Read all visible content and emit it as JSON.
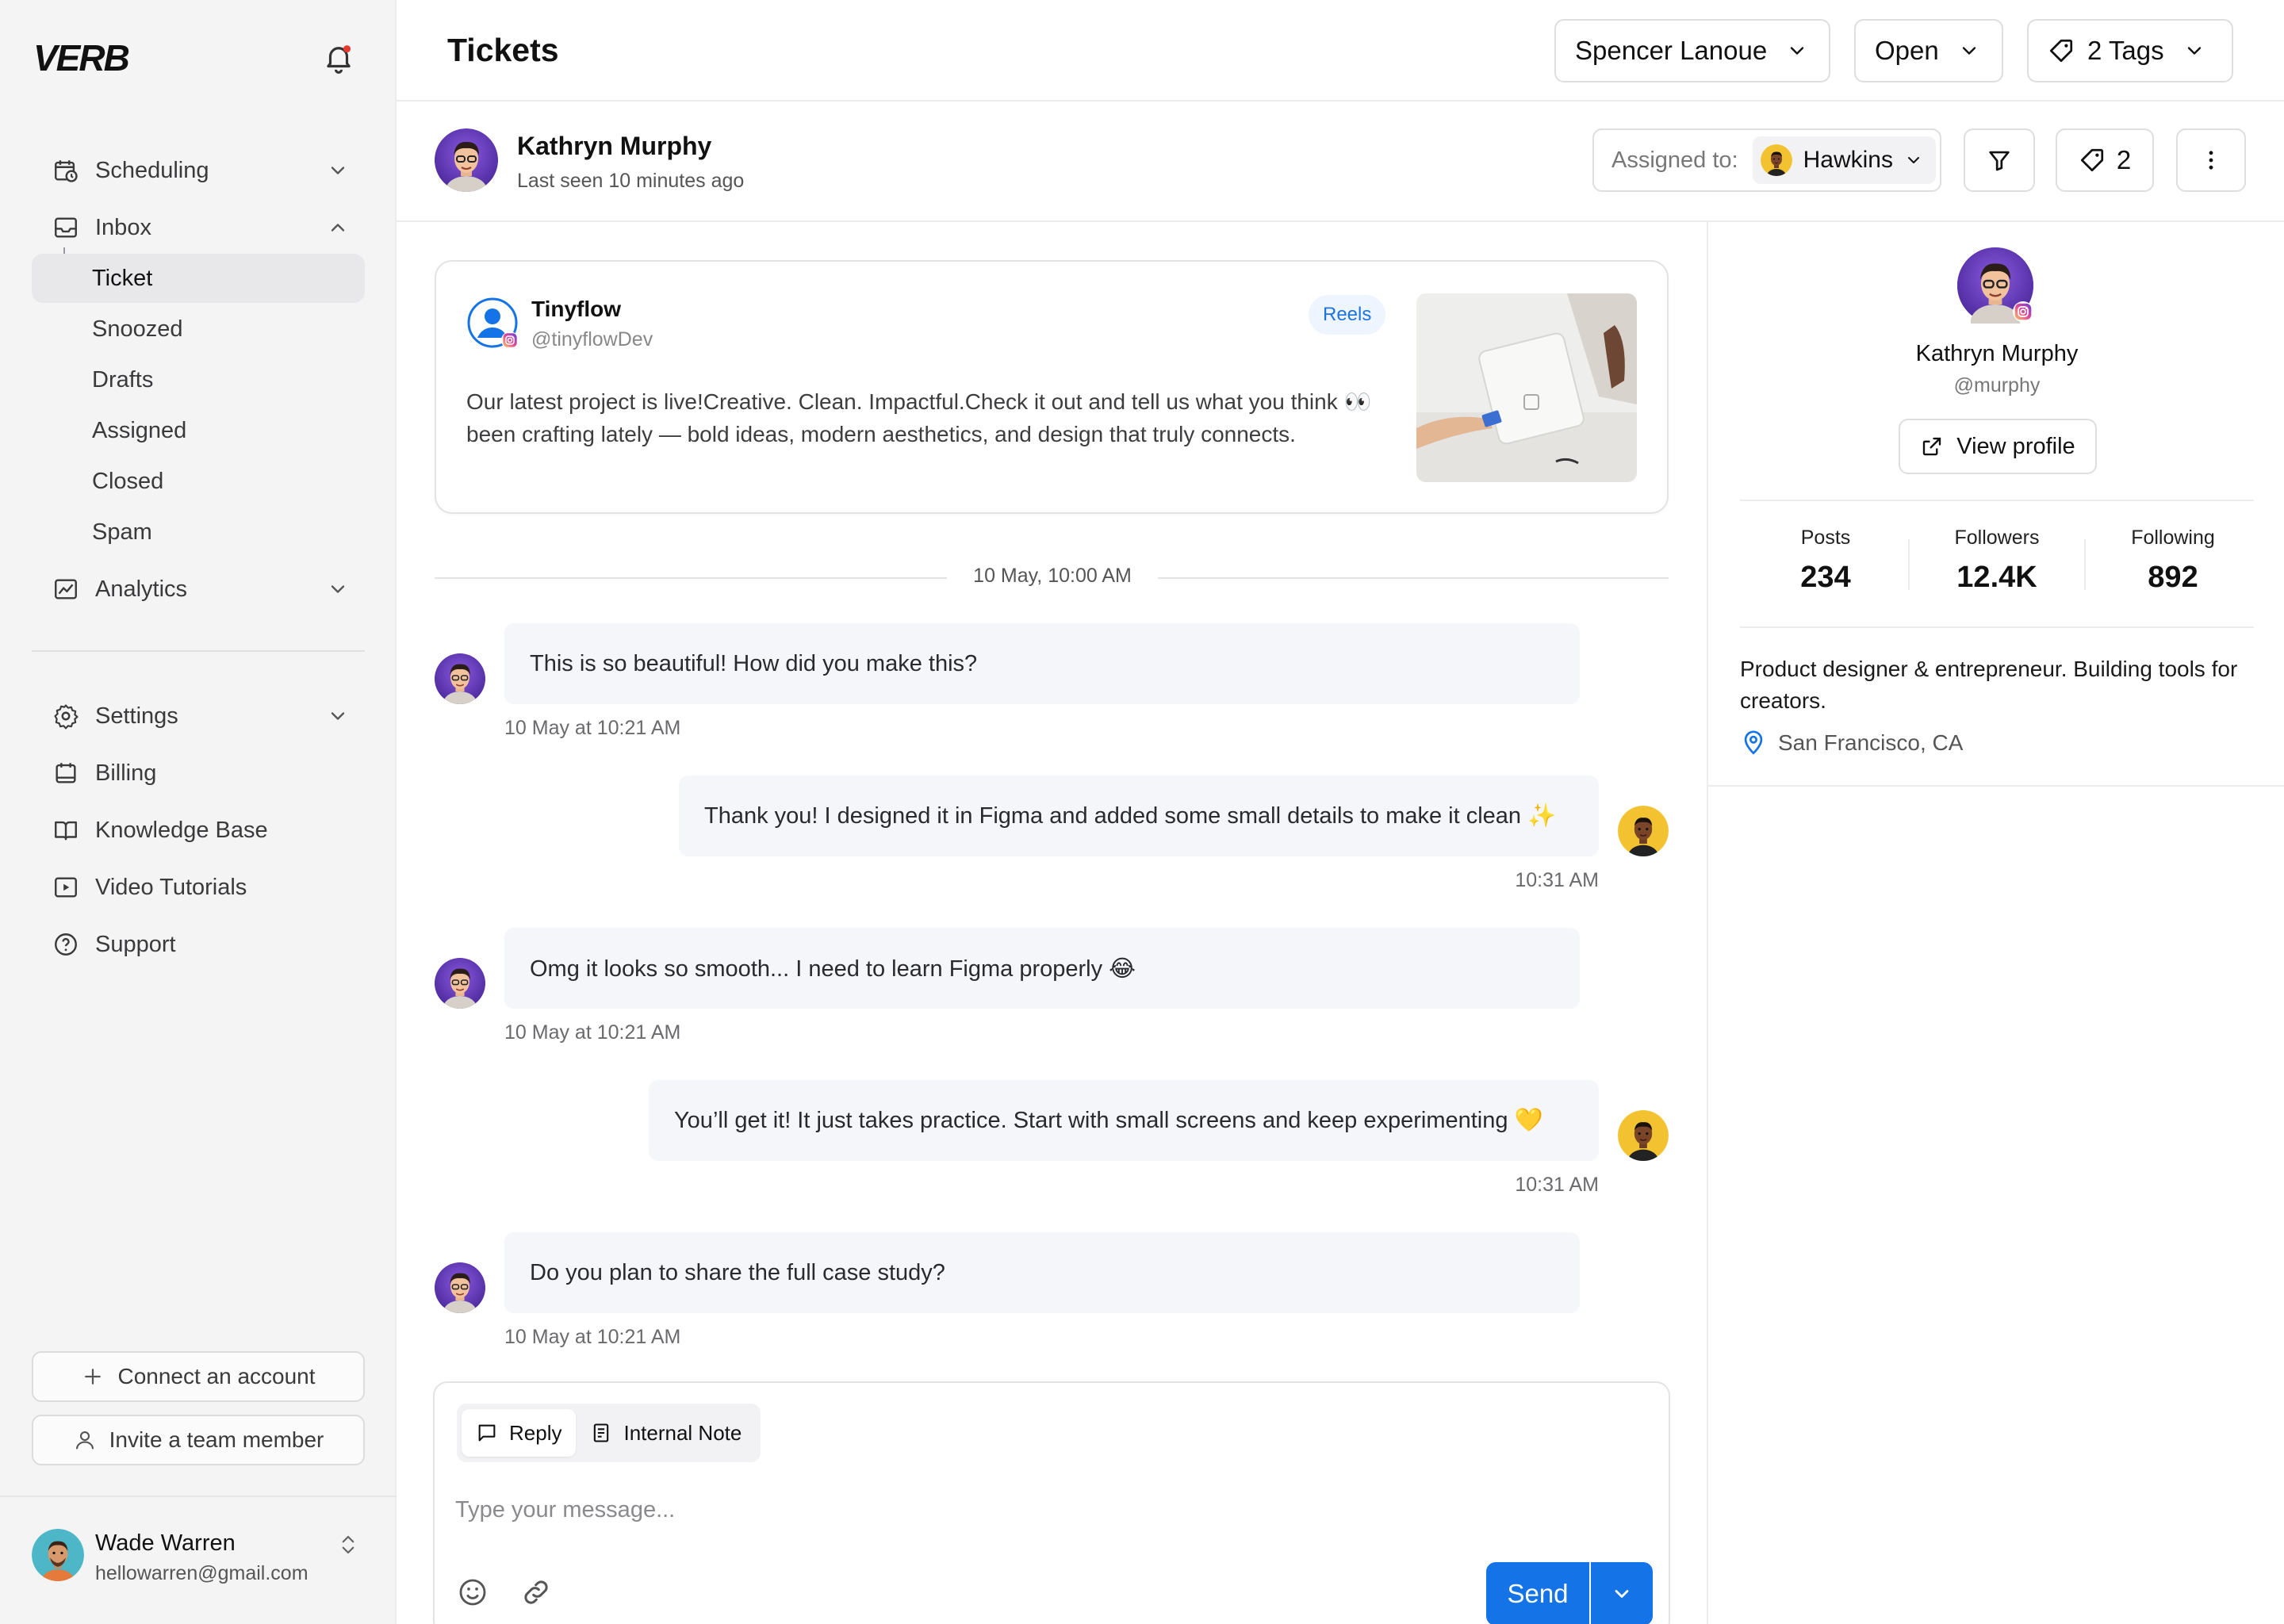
{
  "sidebar": {
    "logo": "VERB",
    "nav": {
      "scheduling": "Scheduling",
      "inbox": "Inbox",
      "inbox_items": [
        "Ticket",
        "Snoozed",
        "Drafts",
        "Assigned",
        "Closed",
        "Spam"
      ],
      "analytics": "Analytics",
      "settings": "Settings",
      "billing": "Billing",
      "knowledge_base": "Knowledge Base",
      "video_tutorials": "Video Tutorials",
      "support": "Support"
    },
    "connect_account": "Connect an account",
    "invite_member": "Invite a team member",
    "user": {
      "name": "Wade Warren",
      "email": "hellowarren@gmail.com"
    }
  },
  "header": {
    "title": "Tickets",
    "filters": {
      "agent": "Spencer Lanoue",
      "status": "Open",
      "tags": "2 Tags"
    }
  },
  "contact": {
    "name": "Kathryn Murphy",
    "last_seen": "Last seen 10 minutes ago",
    "assigned_label": "Assigned to:",
    "assigned_name": "Hawkins",
    "tag_count": "2"
  },
  "post": {
    "author": "Tinyflow",
    "handle": "@tinyflowDev",
    "badge": "Reels",
    "text": "Our latest project is live!Creative. Clean. Impactful.Check it out and tell us what you think 👀 been crafting lately — bold ideas, modern aesthetics, and design that truly connects."
  },
  "conversation": {
    "date_separator": "10 May, 10:00 AM",
    "messages": [
      {
        "direction": "in",
        "text": "This is so beautiful! How did you make this?",
        "time": "10 May at 10:21 AM"
      },
      {
        "direction": "out",
        "text": "Thank you! I designed it in Figma and added some small details to make it clean ✨",
        "time": "10:31 AM"
      },
      {
        "direction": "in",
        "text": "Omg it looks so smooth... I need to learn Figma properly 😂",
        "time": "10 May at 10:21 AM"
      },
      {
        "direction": "out",
        "text": "You’ll get it! It just takes practice. Start with small screens and keep experimenting 💛",
        "time": "10:31 AM"
      },
      {
        "direction": "in",
        "text": "Do you plan to share the full case study?",
        "time": "10 May at 10:21 AM"
      }
    ]
  },
  "composer": {
    "tab_reply": "Reply",
    "tab_note": "Internal Note",
    "placeholder": "Type your message...",
    "send": "Send"
  },
  "profile": {
    "name": "Kathryn Murphy",
    "handle": "@murphy",
    "view_profile": "View profile",
    "stats": [
      {
        "label": "Posts",
        "value": "234"
      },
      {
        "label": "Followers",
        "value": "12.4K"
      },
      {
        "label": "Following",
        "value": "892"
      }
    ],
    "bio": "Product designer & entrepreneur. Building tools for creators.",
    "location": "San Francisco, CA"
  },
  "colors": {
    "accent": "#1473e6",
    "sidebar_bg": "#f4f4f5",
    "bubble_bg": "#f4f6fa"
  }
}
